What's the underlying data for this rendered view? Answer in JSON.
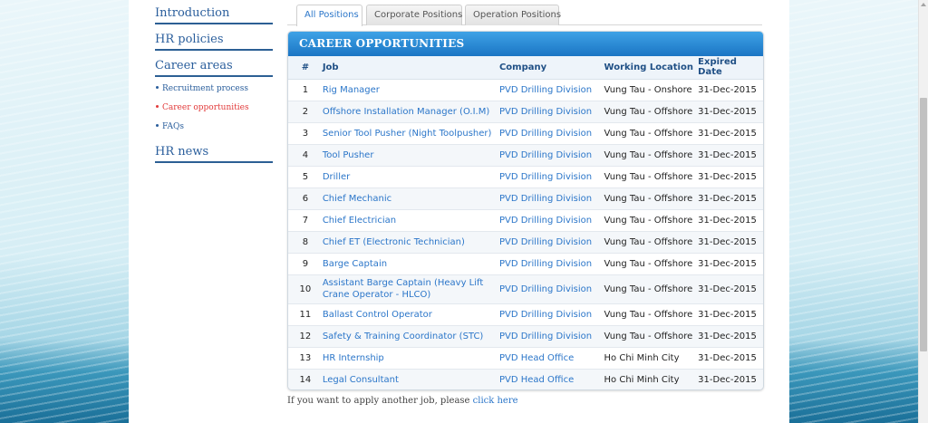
{
  "sidebar": {
    "introduction": "Introduction",
    "hr_policies": "HR policies",
    "career_areas": "Career areas",
    "sub_items": [
      {
        "label": "Recruitment process",
        "active": false
      },
      {
        "label": "Career opportunities",
        "active": true
      },
      {
        "label": "FAQs",
        "active": false
      }
    ],
    "hr_news": "HR news"
  },
  "tabs": [
    {
      "label": "All Positions",
      "active": true
    },
    {
      "label": "Corporate Positions",
      "active": false
    },
    {
      "label": "Operation Positions",
      "active": false
    }
  ],
  "panel": {
    "title": "CAREER OPPORTUNITIES",
    "columns": [
      "#",
      "Job",
      "Company",
      "Working Location",
      "Expired Date"
    ],
    "rows": [
      {
        "num": "1",
        "job": "Rig Manager",
        "company": "PVD Drilling Division",
        "location": "Vung Tau - Onshore",
        "expired": "31-Dec-2015"
      },
      {
        "num": "2",
        "job": "Offshore Installation Manager (O.I.M)",
        "company": "PVD Drilling Division",
        "location": "Vung Tau - Offshore",
        "expired": "31-Dec-2015"
      },
      {
        "num": "3",
        "job": "Senior Tool Pusher (Night Toolpusher)",
        "company": "PVD Drilling Division",
        "location": "Vung Tau - Offshore",
        "expired": "31-Dec-2015"
      },
      {
        "num": "4",
        "job": "Tool Pusher",
        "company": "PVD Drilling Division",
        "location": "Vung Tau - Offshore",
        "expired": "31-Dec-2015"
      },
      {
        "num": "5",
        "job": "Driller",
        "company": "PVD Drilling Division",
        "location": "Vung Tau - Offshore",
        "expired": "31-Dec-2015"
      },
      {
        "num": "6",
        "job": "Chief Mechanic",
        "company": "PVD Drilling Division",
        "location": "Vung Tau - Offshore",
        "expired": "31-Dec-2015"
      },
      {
        "num": "7",
        "job": "Chief Electrician",
        "company": "PVD Drilling Division",
        "location": "Vung Tau - Offshore",
        "expired": "31-Dec-2015"
      },
      {
        "num": "8",
        "job": "Chief ET (Electronic Technician)",
        "company": "PVD Drilling Division",
        "location": "Vung Tau - Offshore",
        "expired": "31-Dec-2015"
      },
      {
        "num": "9",
        "job": "Barge Captain",
        "company": "PVD Drilling Division",
        "location": "Vung Tau - Offshore",
        "expired": "31-Dec-2015"
      },
      {
        "num": "10",
        "job": "Assistant Barge Captain (Heavy Lift Crane Operator - HLCO)",
        "company": "PVD Drilling Division",
        "location": "Vung Tau - Offshore",
        "expired": "31-Dec-2015"
      },
      {
        "num": "11",
        "job": "Ballast Control Operator",
        "company": "PVD Drilling Division",
        "location": "Vung Tau - Offshore",
        "expired": "31-Dec-2015"
      },
      {
        "num": "12",
        "job": "Safety & Training Coordinator (STC)",
        "company": "PVD Drilling Division",
        "location": "Vung Tau - Offshore",
        "expired": "31-Dec-2015"
      },
      {
        "num": "13",
        "job": "HR Internship",
        "company": "PVD Head Office",
        "location": "Ho Chi Minh City",
        "expired": "31-Dec-2015"
      },
      {
        "num": "14",
        "job": "Legal Consultant",
        "company": "PVD Head Office",
        "location": "Ho Chi Minh City",
        "expired": "31-Dec-2015"
      }
    ]
  },
  "footer": {
    "text": "If you want to apply another job, please ",
    "link": "click here"
  },
  "colors": {
    "accent": "#2b76c9",
    "header_gradient_top": "#3ea2e6",
    "header_gradient_bottom": "#1b75c4",
    "active_sidebar": "#e23b3b"
  }
}
